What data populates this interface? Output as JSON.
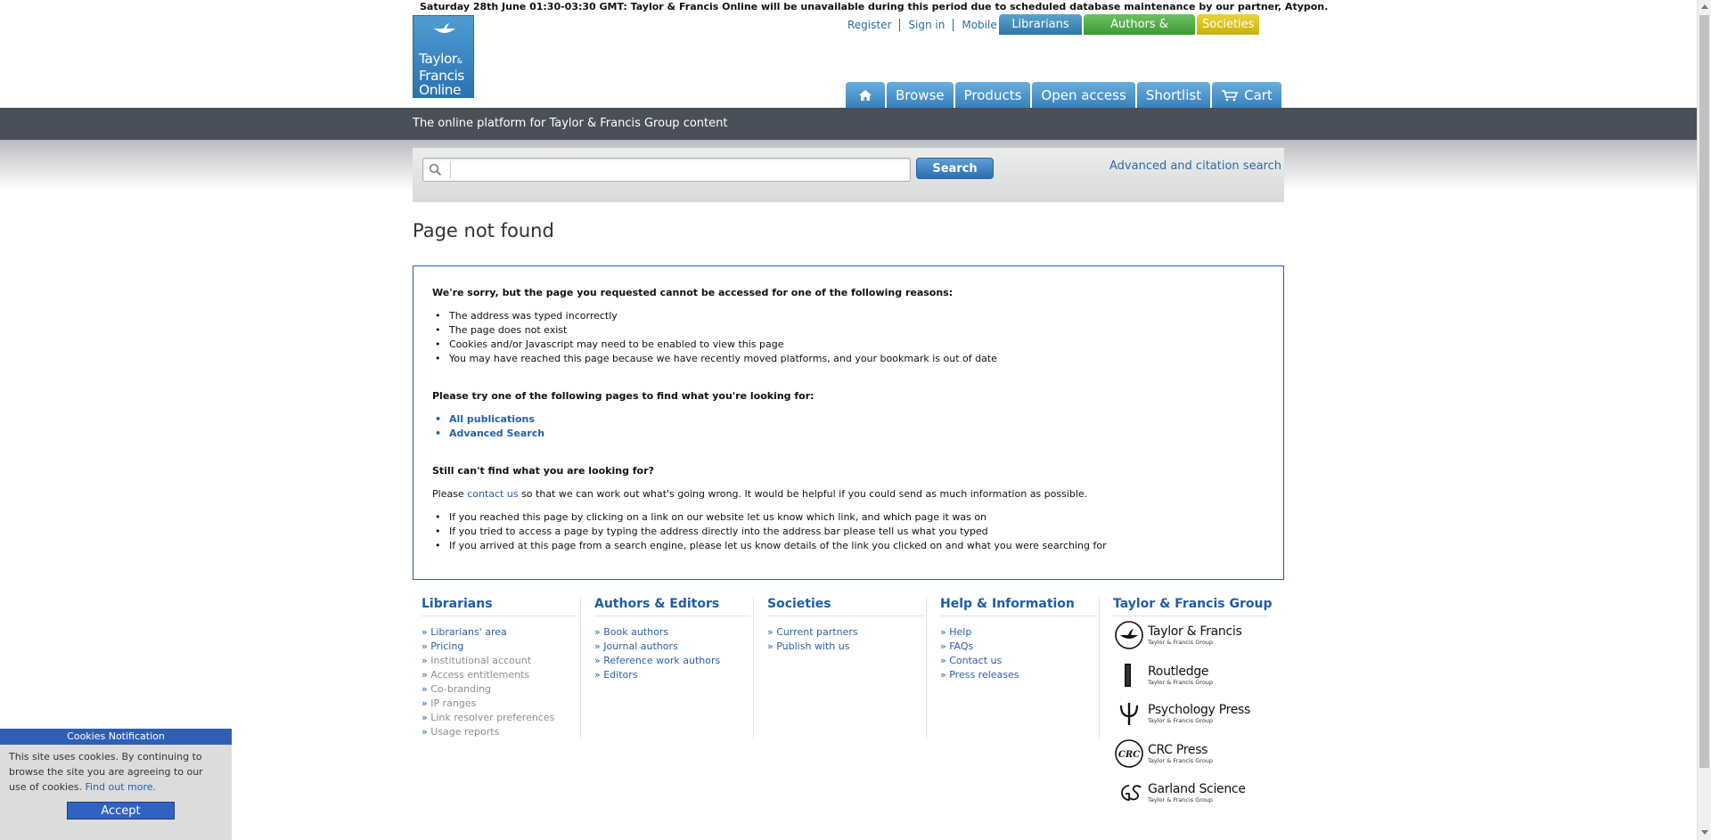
{
  "notice": "Saturday 28th June 01:30-03:30 GMT: Taylor & Francis Online will be unavailable during this period due to scheduled database maintenance by our partner, Atypon.",
  "logo": {
    "line1": "Taylor",
    "amp": "&",
    "line2": "Francis",
    "line3": "Online"
  },
  "utility_links": [
    "Register",
    "Sign in",
    "Mobile"
  ],
  "group_tabs": {
    "librarians": "Librarians",
    "authors": "Authors & Editors",
    "societies": "Societies"
  },
  "nav": {
    "browse": "Browse",
    "products": "Products",
    "open_access": "Open access",
    "shortlist": "Shortlist",
    "cart": "Cart"
  },
  "tagline": "The online platform for Taylor & Francis Group content",
  "search": {
    "button": "Search",
    "placeholder": "",
    "advanced": "Advanced and citation search"
  },
  "page_title": "Page not found",
  "message": {
    "intro": "We're sorry, but the page you requested cannot be accessed for one of the following reasons:",
    "reasons": [
      "The address was typed incorrectly",
      "The page does not exist",
      "Cookies and/or Javascript may need to be enabled to view this page",
      "You may have reached this page because we have recently moved platforms, and your bookmark is out of date"
    ],
    "try_heading": "Please try one of the following pages to find what you're looking for:",
    "try_links": [
      "All publications",
      "Advanced Search"
    ],
    "still_heading": "Still can't find what you are looking for?",
    "please_pre": "Please ",
    "contact_link": "contact us",
    "please_post": " so that we can work out what's going wrong. It would be helpful if you could send as much information as possible.",
    "details": [
      "If you reached this page by clicking on a link on our website let us know which link, and which page it was on",
      "If you tried to access a page by typing the address directly into the address bar please tell us what you typed",
      "If you arrived at this page from a search engine, please let us know details of the link you clicked on and what you were searching for"
    ]
  },
  "footer": {
    "librarians": {
      "title": "Librarians",
      "items": [
        "Librarians' area",
        "Pricing",
        "Institutional account",
        "Access entitlements",
        "Co-branding",
        "IP ranges",
        "Link resolver preferences",
        "Usage reports"
      ]
    },
    "authors": {
      "title": "Authors & Editors",
      "items": [
        "Book authors",
        "Journal authors",
        "Reference work authors",
        "Editors"
      ]
    },
    "societies": {
      "title": "Societies",
      "items": [
        "Current partners",
        "Publish with us"
      ]
    },
    "help": {
      "title": "Help & Information",
      "items": [
        "Help",
        "FAQs",
        "Contact us",
        "Press releases"
      ]
    },
    "group": {
      "title": "Taylor & Francis Group"
    },
    "brands": [
      {
        "name": "Taylor & Francis",
        "sub": "Taylor & Francis Group"
      },
      {
        "name": "Routledge",
        "sub": "Taylor & Francis Group"
      },
      {
        "name": "Psychology Press",
        "sub": "Taylor & Francis Group"
      },
      {
        "name": "CRC Press",
        "sub": "Taylor & Francis Group"
      },
      {
        "name": "Garland Science",
        "sub": "Taylor & Francis Group"
      }
    ],
    "arrow": "»"
  },
  "cookies": {
    "title": "Cookies Notification",
    "text": "This site uses cookies. By continuing to browse the site you are agreeing to our use of cookies.",
    "link": "Find out more.",
    "accept": "Accept"
  },
  "colors": {
    "nav_blue": "#3681bd",
    "dark_bar": "#4a5059",
    "librarians": "#2f76a8",
    "authors": "#3e9a35",
    "societies": "#c8b10f",
    "link": "#2a5fa5"
  }
}
